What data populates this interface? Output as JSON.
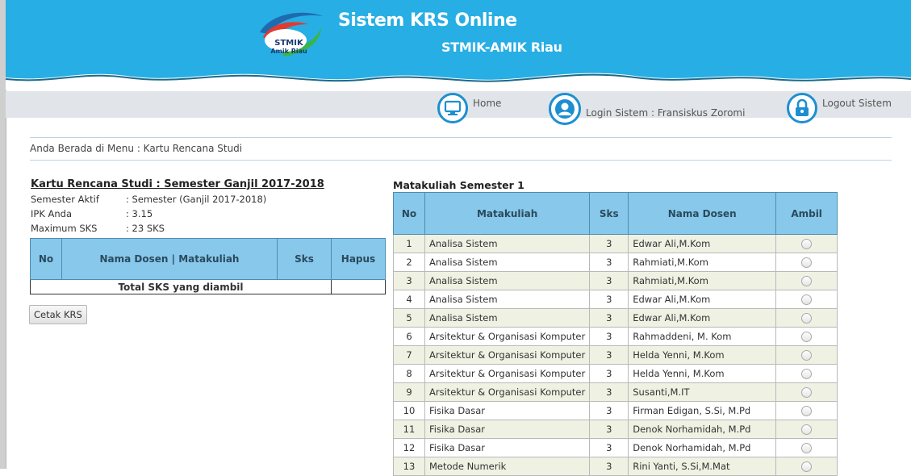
{
  "header": {
    "title": "Sistem KRS Online",
    "subtitle": "STMIK-AMIK Riau",
    "logo_text_1": "STMIK",
    "logo_text_2": "Amik Riau"
  },
  "menu": {
    "home": "Home",
    "login": "Login Sistem : Fransiskus Zoromi",
    "logout": "Logout Sistem"
  },
  "breadcrumb": "Anda Berada di Menu : Kartu Rencana Studi",
  "krs": {
    "title": "Kartu Rencana Studi : Semester Ganjil 2017-2018",
    "info": [
      {
        "label": "Semester Aktif",
        "value": ": Semester (Ganjil 2017-2018)"
      },
      {
        "label": "IPK Anda",
        "value": ": 3.15"
      },
      {
        "label": "Maximum SKS",
        "value": ": 23 SKS"
      }
    ],
    "columns": [
      "No",
      "Nama Dosen | Matakuliah",
      "Sks",
      "Hapus"
    ],
    "total_label": "Total SKS yang diambil",
    "print_button": "Cetak KRS"
  },
  "matakuliah": {
    "title": "Matakuliah Semester 1",
    "columns": [
      "No",
      "Matakuliah",
      "Sks",
      "Nama Dosen",
      "Ambil"
    ],
    "rows": [
      {
        "no": "1",
        "mk": "Analisa Sistem",
        "sks": "3",
        "dosen": "Edwar Ali,M.Kom"
      },
      {
        "no": "2",
        "mk": "Analisa Sistem",
        "sks": "3",
        "dosen": "Rahmiati,M.Kom"
      },
      {
        "no": "3",
        "mk": "Analisa Sistem",
        "sks": "3",
        "dosen": "Rahmiati,M.Kom"
      },
      {
        "no": "4",
        "mk": "Analisa Sistem",
        "sks": "3",
        "dosen": "Edwar Ali,M.Kom"
      },
      {
        "no": "5",
        "mk": "Analisa Sistem",
        "sks": "3",
        "dosen": "Edwar Ali,M.Kom"
      },
      {
        "no": "6",
        "mk": "Arsitektur & Organisasi Komputer",
        "sks": "3",
        "dosen": "Rahmaddeni, M. Kom"
      },
      {
        "no": "7",
        "mk": "Arsitektur & Organisasi Komputer",
        "sks": "3",
        "dosen": "Helda Yenni, M.Kom"
      },
      {
        "no": "8",
        "mk": "Arsitektur & Organisasi Komputer",
        "sks": "3",
        "dosen": "Helda Yenni, M.Kom"
      },
      {
        "no": "9",
        "mk": "Arsitektur & Organisasi Komputer",
        "sks": "3",
        "dosen": "Susanti,M.IT"
      },
      {
        "no": "10",
        "mk": "Fisika Dasar",
        "sks": "3",
        "dosen": "Firman Edigan, S.Si, M.Pd"
      },
      {
        "no": "11",
        "mk": "Fisika Dasar",
        "sks": "3",
        "dosen": "Denok Norhamidah, M.Pd"
      },
      {
        "no": "12",
        "mk": "Fisika Dasar",
        "sks": "3",
        "dosen": "Denok Norhamidah, M.Pd"
      },
      {
        "no": "13",
        "mk": "Metode Numerik",
        "sks": "3",
        "dosen": "Rini Yanti, S.Si,M.Mat"
      }
    ]
  },
  "colors": {
    "header_blue": "#27aee4",
    "table_header": "#88c8ea",
    "row_alt": "#eff1e3",
    "icon_blue": "#1d8fd1"
  },
  "icons": {
    "home": "monitor-icon",
    "login": "user-icon",
    "logout": "lock-icon"
  }
}
